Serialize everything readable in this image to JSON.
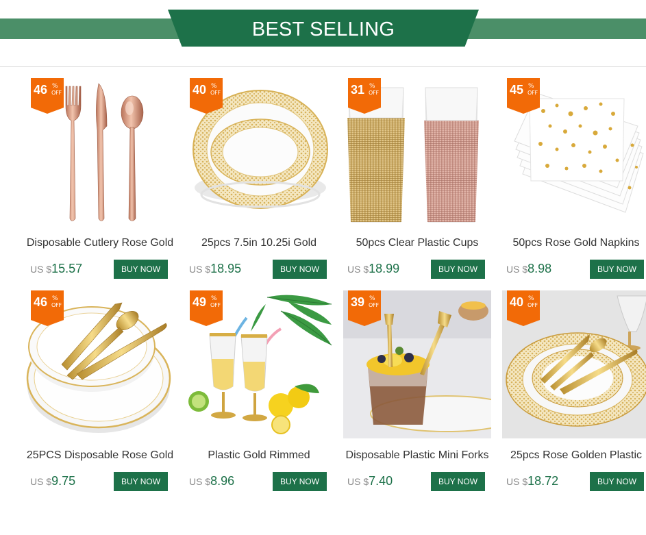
{
  "header": {
    "title": "BEST SELLING"
  },
  "labels": {
    "percent": "%",
    "off": "OFF",
    "currency": "US $",
    "buy": "BUY NOW"
  },
  "colors": {
    "brand_green": "#1d7149",
    "band_green": "#4b8f68",
    "badge_orange": "#f26a07"
  },
  "products": [
    {
      "title": "Disposable Cutlery Rose Gold",
      "discount": "46",
      "price": "15.57",
      "image": "rose-gold-cutlery"
    },
    {
      "title": "25pcs 7.5in 10.25i Gold",
      "discount": "40",
      "price": "18.95",
      "image": "gold-lace-plates"
    },
    {
      "title": "50pcs Clear Plastic Cups",
      "discount": "31",
      "price": "18.99",
      "image": "plastic-cups-stacks"
    },
    {
      "title": "50pcs Rose Gold Napkins",
      "discount": "45",
      "price": "8.98",
      "image": "gold-dot-napkins"
    },
    {
      "title": "25PCS Disposable Rose Gold",
      "discount": "46",
      "price": "9.75",
      "image": "gold-rim-plates-cutlery"
    },
    {
      "title": "Plastic Gold Rimmed",
      "discount": "49",
      "price": "8.96",
      "image": "gold-rimmed-champagne-flutes"
    },
    {
      "title": "Disposable Plastic Mini Forks",
      "discount": "39",
      "price": "7.40",
      "image": "mini-dessert-forks"
    },
    {
      "title": "25pcs Rose Golden Plastic",
      "discount": "40",
      "price": "18.72",
      "image": "rose-gold-plate-set"
    }
  ]
}
